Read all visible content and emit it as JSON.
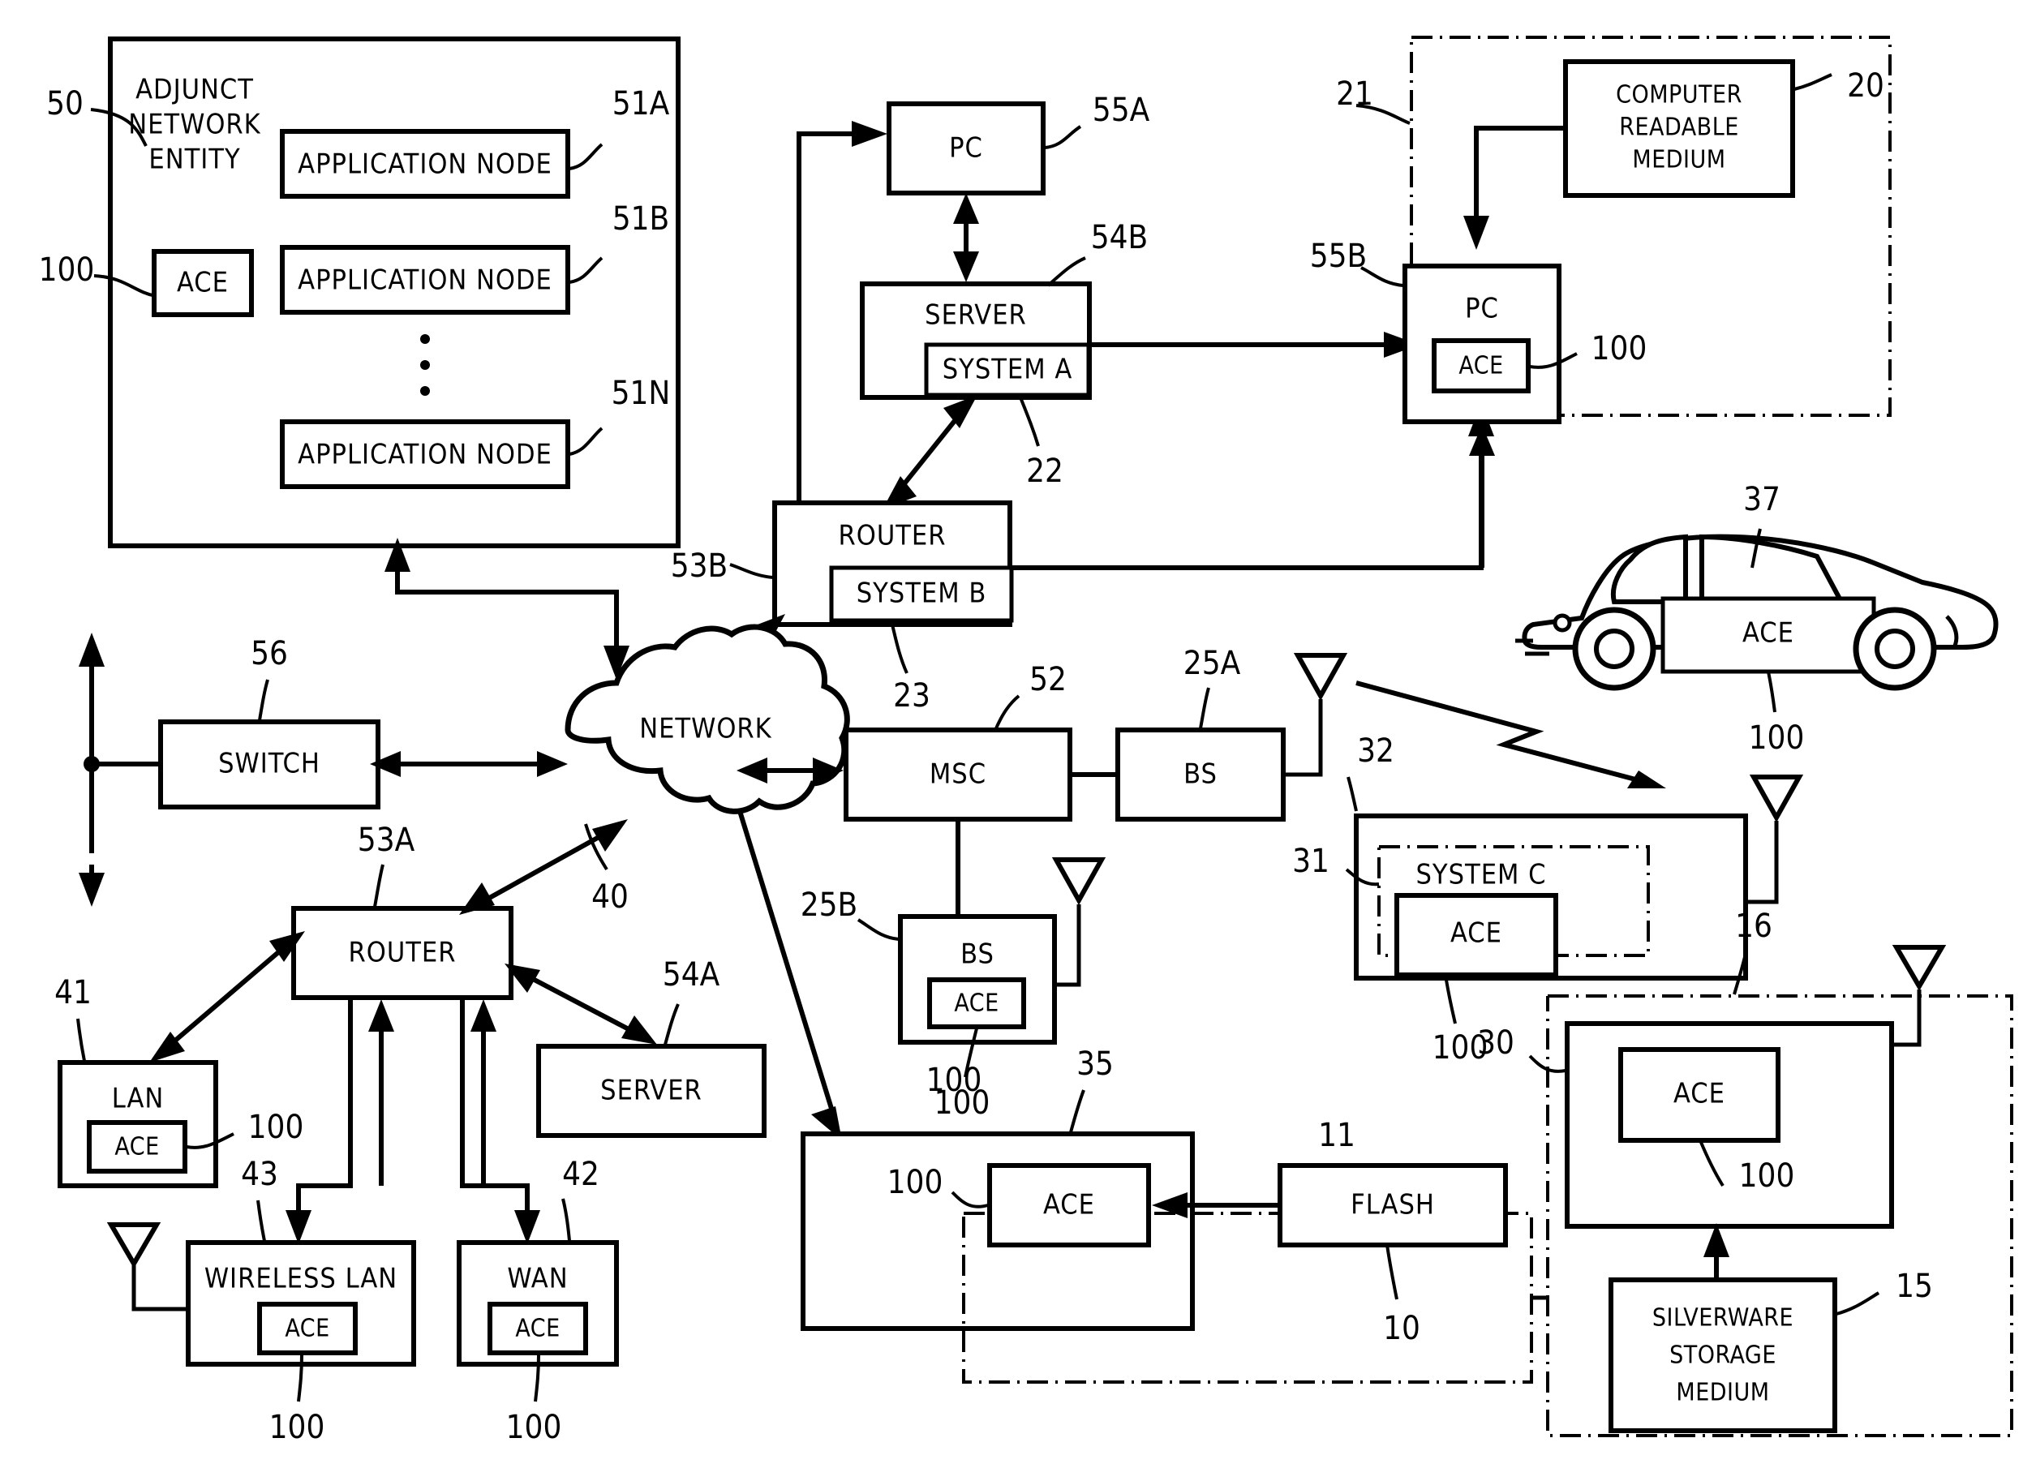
{
  "figure": {
    "kind": "patent-network-diagram",
    "ink": "#000000",
    "paper": "#ffffff"
  },
  "adjunct": {
    "title_l1": "ADJUNCT",
    "title_l2": "NETWORK",
    "title_l3": "ENTITY",
    "ref": "50",
    "ace_label": "ACE",
    "ace_ref": "100",
    "nodes": [
      {
        "label": "APPLICATION NODE",
        "ref": "51A"
      },
      {
        "label": "APPLICATION NODE",
        "ref": "51B"
      },
      {
        "label": "APPLICATION NODE",
        "ref": "51N"
      }
    ],
    "ellipsis": "⋮"
  },
  "center": {
    "pc_top": {
      "label": "PC",
      "ref": "55A"
    },
    "server": {
      "label": "SERVER",
      "sub": "SYSTEM A",
      "ref": "54B",
      "sub_ref": "22"
    },
    "router": {
      "label": "ROUTER",
      "sub": "SYSTEM B",
      "ref": "53B",
      "sub_ref": "23"
    },
    "network": {
      "label": "NETWORK",
      "ref": "40"
    },
    "switch": {
      "label": "SWITCH",
      "ref": "56"
    },
    "msc": {
      "label": "MSC",
      "ref": "52"
    },
    "bs_a": {
      "label": "BS",
      "ref": "25A"
    },
    "bs_b": {
      "label": "BS",
      "ace_label": "ACE",
      "ref": "25B",
      "ace_ref": "100"
    }
  },
  "topright": {
    "enclosure_ref": "21",
    "medium": {
      "l1": "COMPUTER",
      "l2": "READABLE",
      "l3": "MEDIUM",
      "ref": "20"
    },
    "pc": {
      "label": "PC",
      "ref": "55B",
      "ace_label": "ACE",
      "ace_ref": "100"
    }
  },
  "car": {
    "ref": "37",
    "ace_label": "ACE",
    "ace_ref": "100"
  },
  "systemc": {
    "label": "SYSTEM C",
    "ace_label": "ACE",
    "outer_ref": "32",
    "inner_ref": "31",
    "ace_ref": "100"
  },
  "bottomleft": {
    "router": {
      "label": "ROUTER",
      "ref": "53A"
    },
    "lan": {
      "label": "LAN",
      "ace_label": "ACE",
      "ref": "41",
      "ace_ref": "100"
    },
    "wireless_lan": {
      "label": "WIRELESS LAN",
      "ace_label": "ACE",
      "ref": "43",
      "ace_ref": "100"
    },
    "wan": {
      "label": "WAN",
      "ace_label": "ACE",
      "ref": "42",
      "ace_ref": "100"
    },
    "server": {
      "label": "SERVER",
      "ref": "54A"
    }
  },
  "bottommid": {
    "outer_ref": "35",
    "dashed_ref": "11",
    "ace_label": "ACE",
    "ace_ref_outer": "100",
    "ace_ref_inner": "100",
    "flash": {
      "label": "FLASH",
      "ref": "10"
    }
  },
  "bottomright": {
    "dashed_ref": "16",
    "box_ref": "30",
    "ace_label": "ACE",
    "ace_ref": "100",
    "silverware": {
      "l1": "SILVERWARE",
      "l2": "STORAGE",
      "l3": "MEDIUM",
      "ref": "15"
    }
  }
}
